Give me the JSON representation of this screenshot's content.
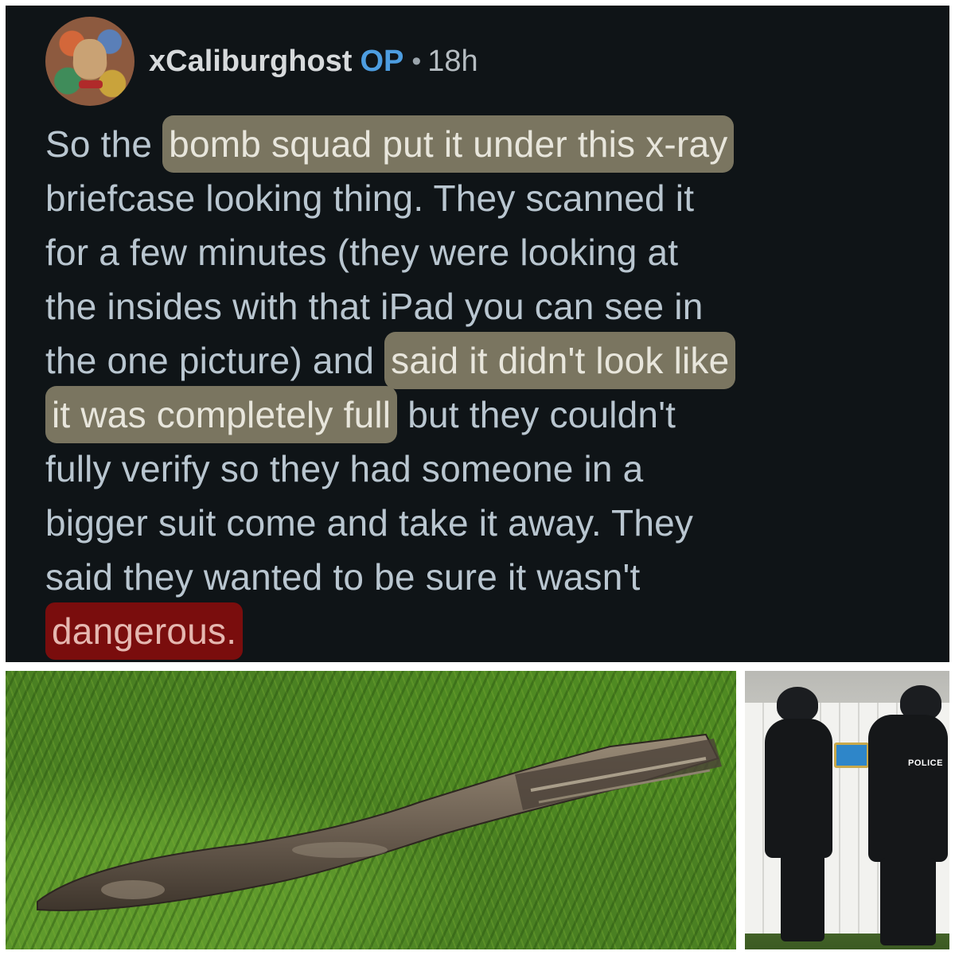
{
  "comment": {
    "author": "xCaliburghost",
    "op_badge": "OP",
    "separator": "•",
    "time": "18h",
    "lines": [
      {
        "segments": [
          {
            "text": "So the ",
            "style": "normal"
          },
          {
            "text": "bomb squad put it under this x-ray",
            "style": "highlight"
          }
        ]
      },
      {
        "segments": [
          {
            "text": "briefcase looking thing. They scanned it",
            "style": "normal"
          }
        ]
      },
      {
        "segments": [
          {
            "text": "for a few minutes (they were looking at",
            "style": "normal"
          }
        ]
      },
      {
        "segments": [
          {
            "text": "the insides with that iPad you can see in",
            "style": "normal"
          }
        ]
      },
      {
        "segments": [
          {
            "text": "the one picture) and ",
            "style": "normal"
          },
          {
            "text": "said it didn't look like",
            "style": "highlight"
          }
        ]
      },
      {
        "segments": [
          {
            "text": "it was completely full",
            "style": "highlight"
          },
          {
            "text": " but they couldn't",
            "style": "normal"
          }
        ]
      },
      {
        "segments": [
          {
            "text": "fully verify so they had someone in a",
            "style": "normal"
          }
        ]
      },
      {
        "segments": [
          {
            "text": "bigger suit come and take it away. They",
            "style": "normal"
          }
        ]
      },
      {
        "segments": [
          {
            "text": "said they wanted to be sure it wasn't",
            "style": "normal"
          }
        ]
      },
      {
        "segments": [
          {
            "text": "dangerous.",
            "style": "highlight-red"
          }
        ]
      }
    ]
  },
  "photos": {
    "right_police_label": "POLICE"
  },
  "colors": {
    "panel_bg": "#0f1417",
    "text": "#b9c6d0",
    "op_blue": "#4d9de0",
    "highlight": "#7a7560",
    "highlight_red": "#7a0d0d"
  }
}
